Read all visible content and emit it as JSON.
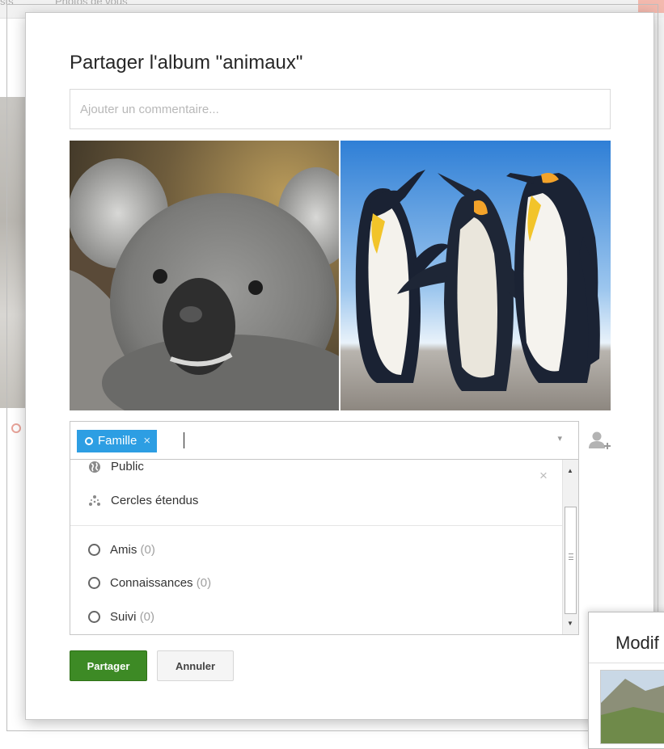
{
  "background": {
    "tab_partial": "sts",
    "tab_photos": "Photos de vous"
  },
  "dialog": {
    "title": "Partager l'album \"animaux\"",
    "comment_placeholder": "Ajouter un commentaire...",
    "photos": [
      {
        "subject": "koala"
      },
      {
        "subject": "penguins"
      }
    ],
    "share_field": {
      "chip_label": "Famille",
      "chip_remove": "×",
      "dropdown_arrow": "▾"
    },
    "dropdown": {
      "close": "×",
      "items": [
        {
          "label": "Public",
          "icon": "globe-icon"
        },
        {
          "label": "Cercles étendus",
          "icon": "extended-circles-icon"
        },
        {
          "label": "Amis",
          "count": "(0)",
          "icon": "circle-icon"
        },
        {
          "label": "Connaissances",
          "count": "(0)",
          "icon": "circle-icon"
        },
        {
          "label": "Suivi",
          "count": "(0)",
          "icon": "circle-icon"
        }
      ],
      "scroll_up": "▲",
      "scroll_down": "▼"
    },
    "buttons": {
      "share": "Partager",
      "cancel": "Annuler"
    }
  },
  "second_dialog": {
    "title_partial": "Modif"
  },
  "colors": {
    "chip": "#2d9ee3",
    "share_button": "#3d8a25"
  }
}
